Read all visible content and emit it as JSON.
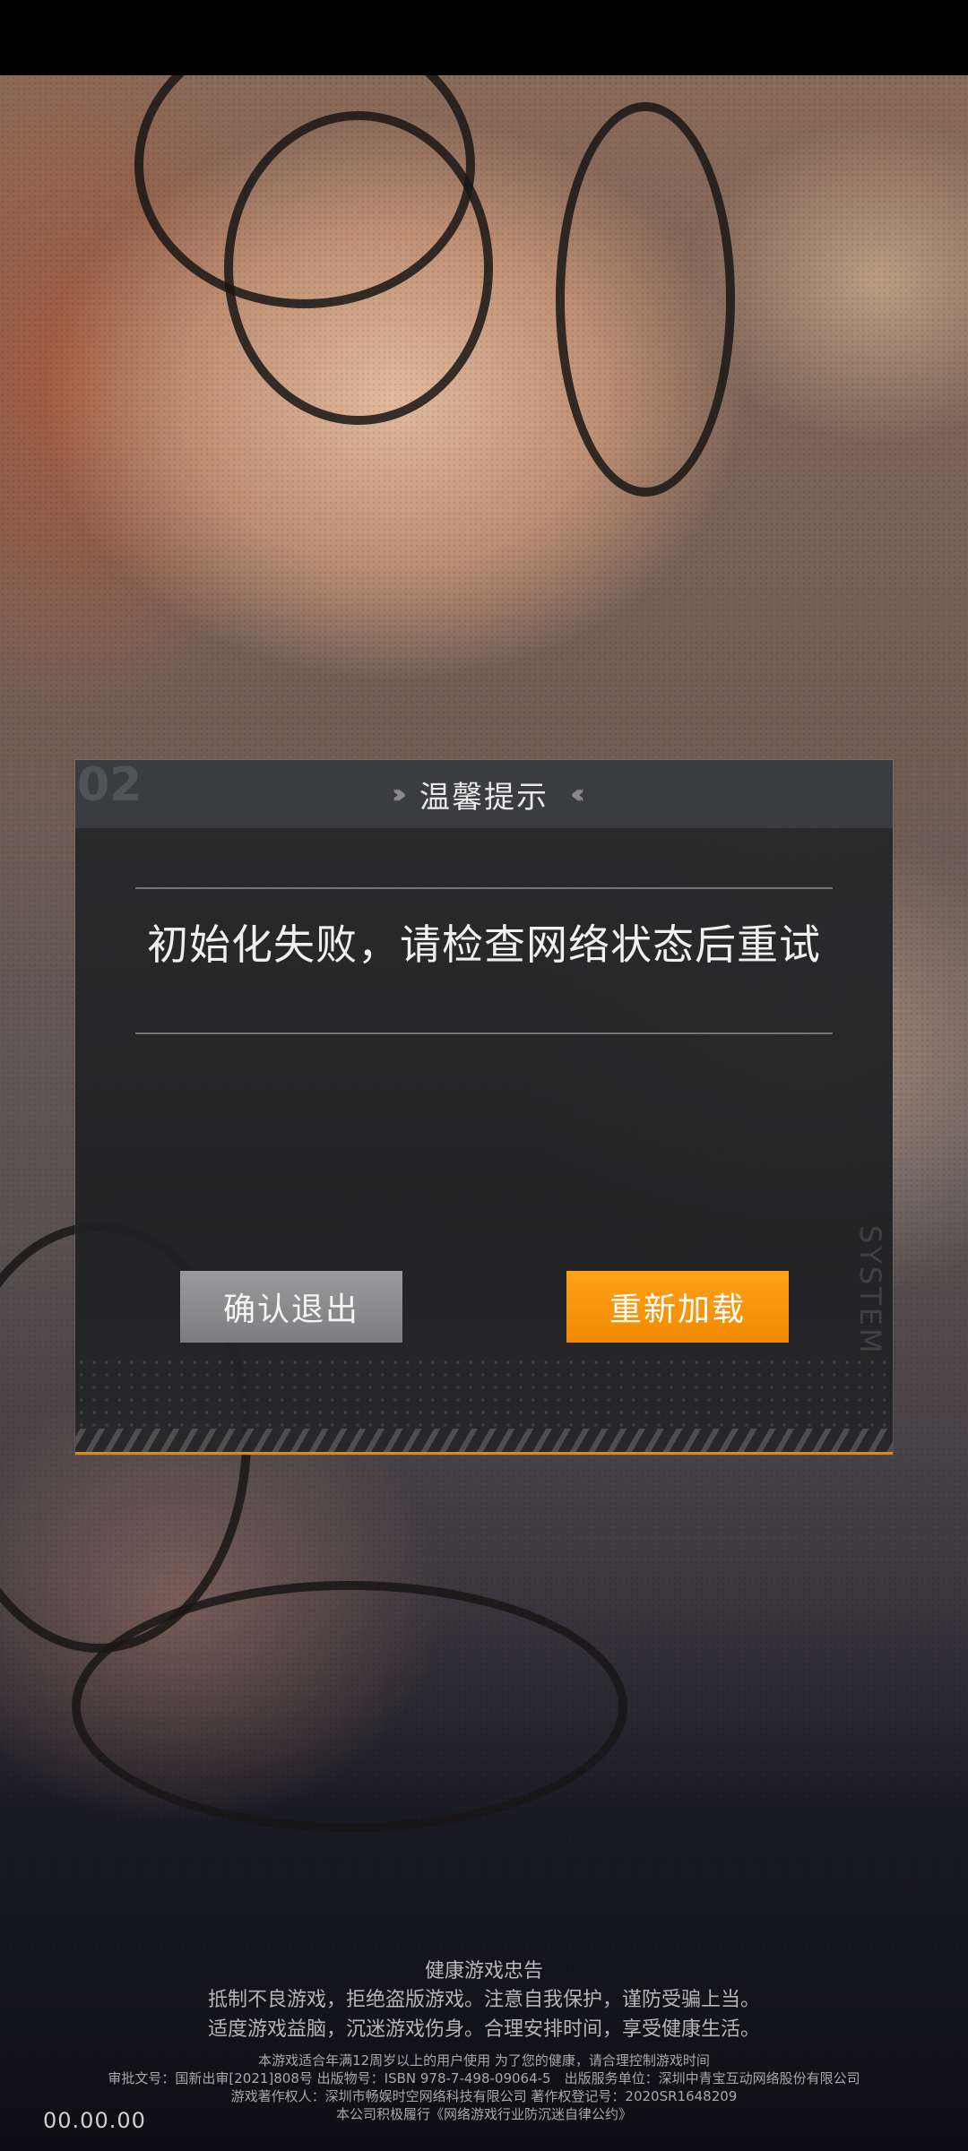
{
  "dialog": {
    "title": "温馨提示",
    "message": "初始化失败，请检查网络状态后重试",
    "corner_mark": "02",
    "side_label": "SYSTEM",
    "exit_label": "确认退出",
    "reload_label": "重新加载"
  },
  "footer": {
    "heading": "健康游戏忠告",
    "advice_1": "抵制不良游戏，拒绝盗版游戏。注意自我保护，谨防受骗上当。",
    "advice_2": "适度游戏益脑，沉迷游戏伤身。合理安排时间，享受健康生活。",
    "legal_1": "本游戏适合年满12周岁以上的用户使用 为了您的健康，请合理控制游戏时间",
    "legal_2": "审批文号：国新出审[2021]808号 出版物号：ISBN 978-7-498-09064-5　出版服务单位：深圳中青宝互动网络股份有限公司",
    "legal_3": "游戏著作权人：深圳市畅娱时空网络科技有限公司 著作权登记号：2020SR1648209",
    "legal_4": "本公司积极履行《网络游戏行业防沉迷自律公约》"
  },
  "version": "00.00.00",
  "colors": {
    "accent": "#f4920a",
    "exit_button": "#8c8c8e",
    "dialog_bg": "#2a2a2c"
  }
}
